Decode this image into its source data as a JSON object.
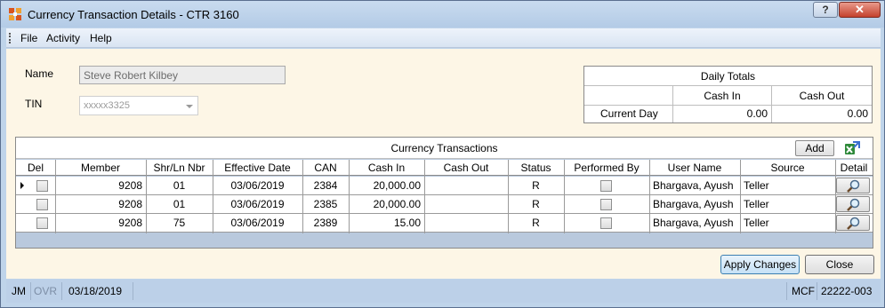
{
  "window": {
    "title": "Currency Transaction Details - CTR 3160",
    "help_label": "?",
    "close_label": "✕"
  },
  "menu": {
    "items": [
      "File",
      "Activity",
      "Help"
    ]
  },
  "form": {
    "name_label": "Name",
    "name_value": "Steve Robert Kilbey",
    "tin_label": "TIN",
    "tin_value": "xxxxx3325"
  },
  "daily_totals": {
    "title": "Daily Totals",
    "cash_in_header": "Cash In",
    "cash_out_header": "Cash Out",
    "row_label": "Current Day",
    "cash_in": "0.00",
    "cash_out": "0.00"
  },
  "transactions": {
    "title": "Currency Transactions",
    "add_label": "Add",
    "columns": [
      "Del",
      "Member",
      "Shr/Ln Nbr",
      "Effective Date",
      "CAN",
      "Cash In",
      "Cash Out",
      "Status",
      "Performed By",
      "User Name",
      "Source",
      "Detail"
    ],
    "rows": [
      {
        "member": "9208",
        "shr_ln": "01",
        "date": "03/06/2019",
        "can": "2384",
        "cash_in": "20,000.00",
        "cash_out": "",
        "status": "R",
        "user": "Bhargava, Ayush",
        "source": "Teller"
      },
      {
        "member": "9208",
        "shr_ln": "01",
        "date": "03/06/2019",
        "can": "2385",
        "cash_in": "20,000.00",
        "cash_out": "",
        "status": "R",
        "user": "Bhargava, Ayush",
        "source": "Teller"
      },
      {
        "member": "9208",
        "shr_ln": "75",
        "date": "03/06/2019",
        "can": "2389",
        "cash_in": "15.00",
        "cash_out": "",
        "status": "R",
        "user": "Bhargava, Ayush",
        "source": "Teller"
      }
    ]
  },
  "actions": {
    "apply_label": "Apply Changes",
    "close_label": "Close"
  },
  "statusbar": {
    "user": "JM",
    "ovr": "OVR",
    "date": "03/18/2019",
    "app": "MCF",
    "code": "22222-003"
  }
}
